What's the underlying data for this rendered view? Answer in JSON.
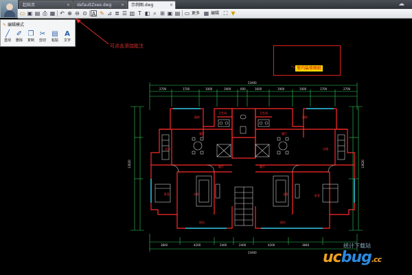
{
  "tabs": [
    {
      "label": "起始页",
      "active": false
    },
    {
      "label": "defaultZxee.dwg",
      "active": false
    },
    {
      "label": "示例图.dwg",
      "active": true
    }
  ],
  "toolbar": {
    "more_label": "更多",
    "edit_label": "编辑"
  },
  "edit_panel": {
    "title": "编辑模式",
    "tools": [
      {
        "label": "直线",
        "icon": "line-icon"
      },
      {
        "label": "删除",
        "icon": "eraser-icon"
      },
      {
        "label": "复制",
        "icon": "copy-icon"
      },
      {
        "label": "剪切",
        "icon": "scissors-icon"
      },
      {
        "label": "粘贴",
        "icon": "paste-icon"
      },
      {
        "label": "文字",
        "icon": "text-icon"
      }
    ]
  },
  "annotation": "可点击添加批注",
  "callout_label": "室内装修图纸",
  "drawing": {
    "top_dims": [
      "2700",
      "1700",
      "1000",
      "1900",
      "600",
      "1600",
      "1900",
      "1000",
      "1700",
      "2700"
    ],
    "top_total": "23400",
    "bottom_dims": [
      "3840",
      "4200",
      "2400",
      "2400",
      "4200",
      "3840"
    ],
    "bottom_total": "23400",
    "side_dim": "13620",
    "room_labels": [
      "厨房",
      "餐厅",
      "卫生间",
      "客厅",
      "主卧",
      "卧室",
      "阳台",
      "过道",
      "厨房",
      "餐厅",
      "卫生间",
      "客厅",
      "主卧",
      "卧室",
      "阳台",
      "过道"
    ]
  },
  "watermark": {
    "url": "统计下载站",
    "logo_a": "uc",
    "logo_b": "bug",
    "logo_c": ".cc"
  },
  "colors": {
    "wall": "#ff2a2a",
    "dimension": "#30d060",
    "room_text": "#ff3030",
    "fixture": "#d0d0d0",
    "window": "#20c8e8",
    "annotation": "#e03030",
    "highlight": "#ffd800"
  }
}
